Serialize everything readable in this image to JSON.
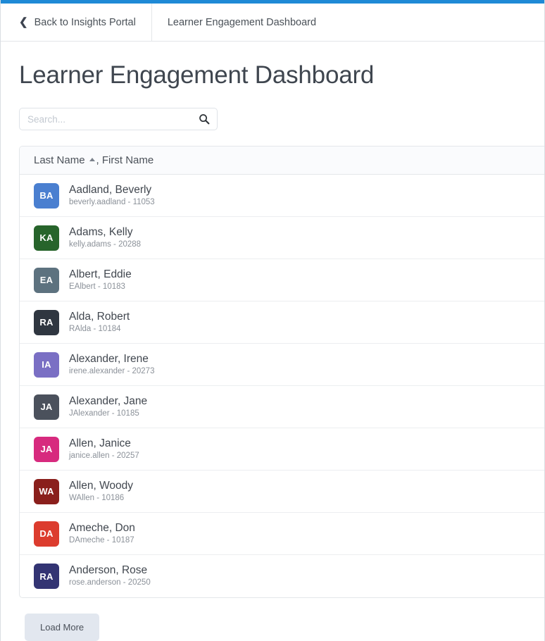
{
  "header": {
    "back_label": "Back to Insights Portal",
    "tab_title": "Learner Engagement Dashboard",
    "back_icon": "chevron-left-icon",
    "accent_color": "#1f8ad6"
  },
  "page_title": "Learner Engagement Dashboard",
  "search": {
    "placeholder": "Search...",
    "value": "",
    "icon": "search-icon"
  },
  "list": {
    "column_header": "Last Name",
    "column_header_suffix": ", First Name",
    "sort_direction": "ascending",
    "rows": [
      {
        "initials": "BA",
        "color": "#4a7fd0",
        "name": "Aadland, Beverly",
        "meta": "beverly.aadland - 11053"
      },
      {
        "initials": "KA",
        "color": "#27642b",
        "name": "Adams, Kelly",
        "meta": "kelly.adams - 20288"
      },
      {
        "initials": "EA",
        "color": "#5d727f",
        "name": "Albert, Eddie",
        "meta": "EAlbert - 10183"
      },
      {
        "initials": "RA",
        "color": "#2f3640",
        "name": "Alda, Robert",
        "meta": "RAlda - 10184"
      },
      {
        "initials": "IA",
        "color": "#7a6fc4",
        "name": "Alexander, Irene",
        "meta": "irene.alexander - 20273"
      },
      {
        "initials": "JA",
        "color": "#4b515c",
        "name": "Alexander, Jane",
        "meta": "JAlexander - 10185"
      },
      {
        "initials": "JA",
        "color": "#d72a7e",
        "name": "Allen, Janice",
        "meta": "janice.allen - 20257"
      },
      {
        "initials": "WA",
        "color": "#8a1f1c",
        "name": "Allen, Woody",
        "meta": "WAllen - 10186"
      },
      {
        "initials": "DA",
        "color": "#dc3c2e",
        "name": "Ameche, Don",
        "meta": "DAmeche - 10187"
      },
      {
        "initials": "RA",
        "color": "#333473",
        "name": "Anderson, Rose",
        "meta": "rose.anderson - 20250"
      }
    ]
  },
  "load_more_label": "Load More"
}
